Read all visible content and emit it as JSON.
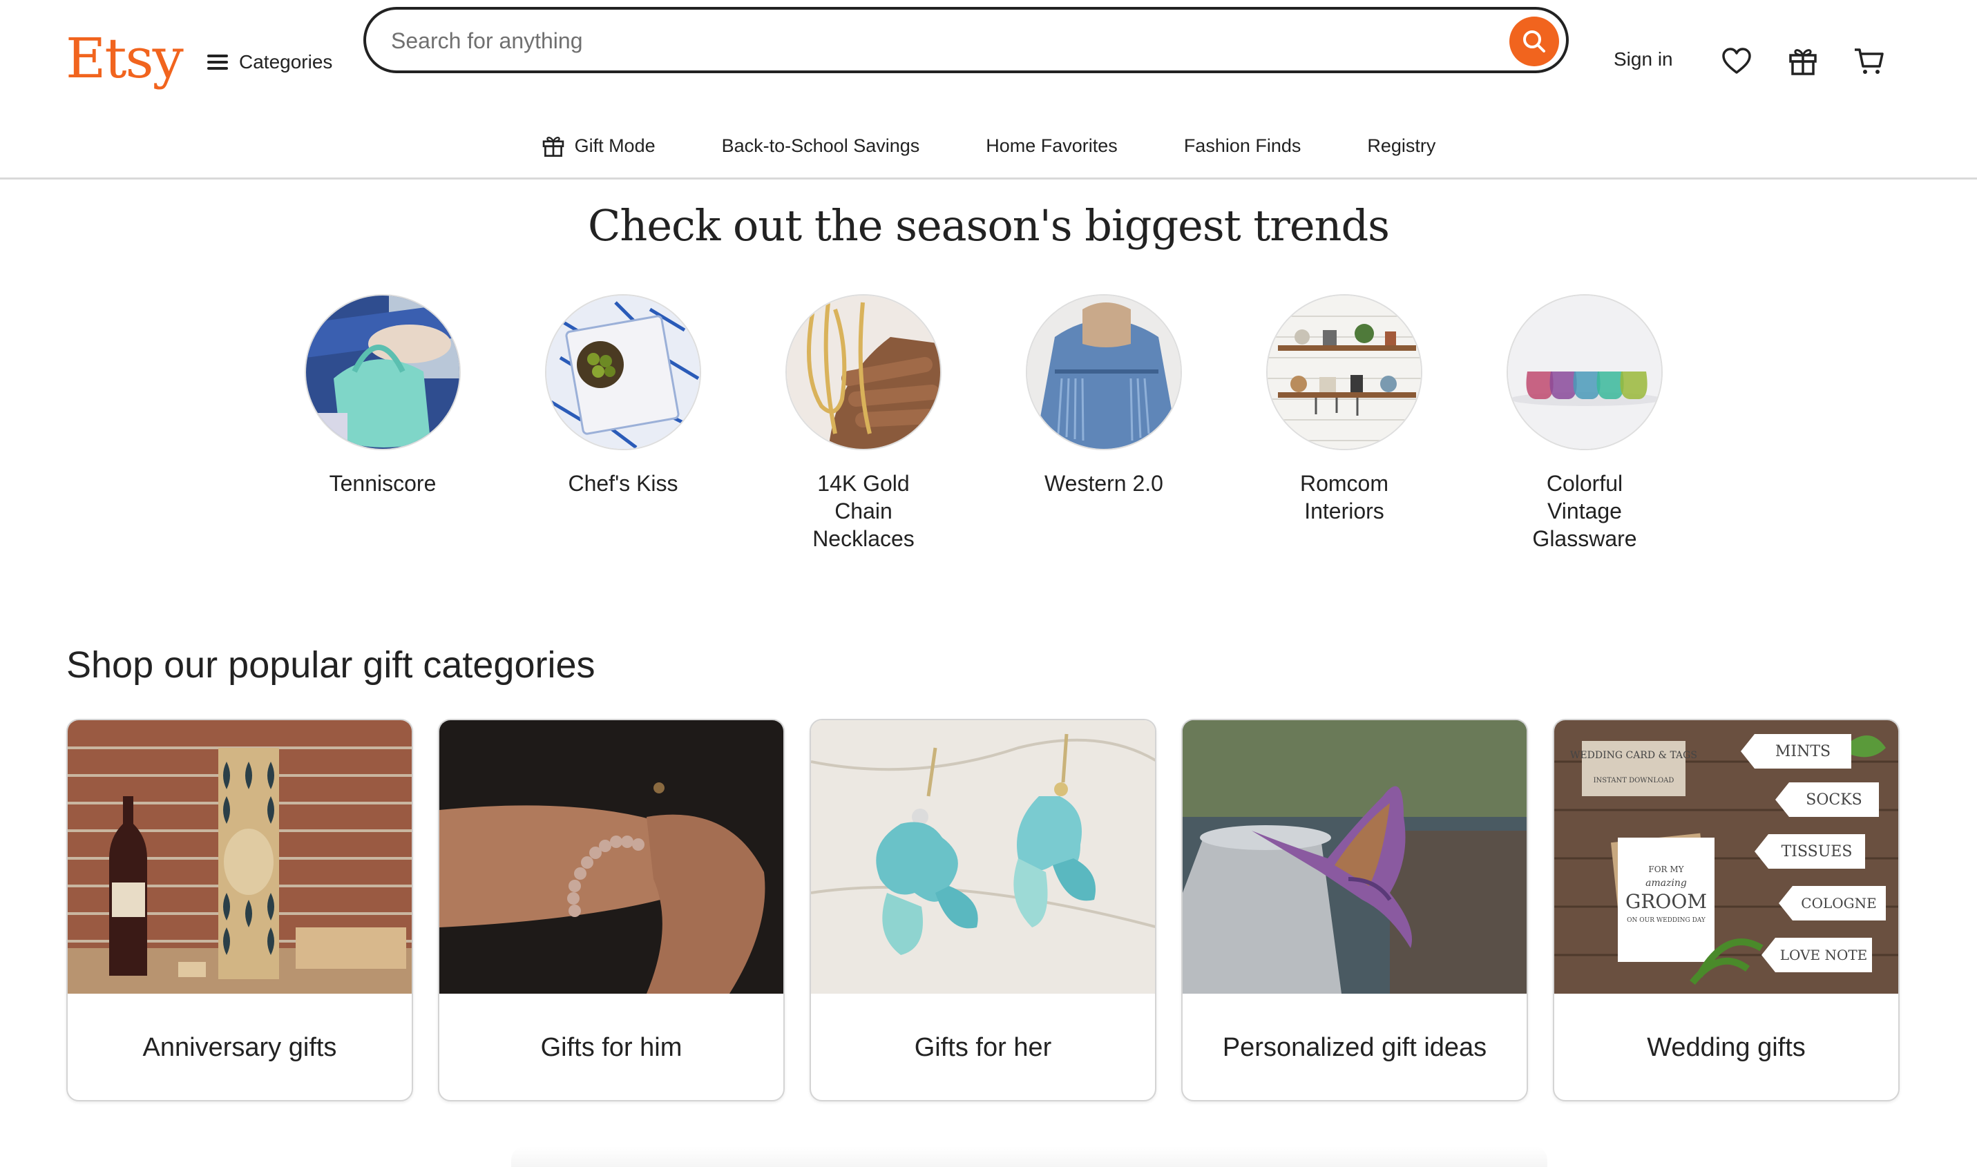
{
  "header": {
    "logo": "Etsy",
    "categories_label": "Categories",
    "search_placeholder": "Search for anything",
    "signin_label": "Sign in"
  },
  "nav": {
    "items": [
      {
        "label": "Gift Mode",
        "icon": "gift-icon"
      },
      {
        "label": "Back-to-School Savings"
      },
      {
        "label": "Home Favorites"
      },
      {
        "label": "Fashion Finds"
      },
      {
        "label": "Registry"
      }
    ]
  },
  "trends": {
    "title": "Check out the season's biggest trends",
    "items": [
      {
        "label": "Tenniscore"
      },
      {
        "label": "Chef's Kiss"
      },
      {
        "label": "14K Gold Chain Necklaces"
      },
      {
        "label": "Western 2.0"
      },
      {
        "label": "Romcom Interiors"
      },
      {
        "label": "Colorful Vintage Glassware"
      }
    ]
  },
  "gifts": {
    "title": "Shop our popular gift categories",
    "items": [
      {
        "label": "Anniversary gifts"
      },
      {
        "label": "Gifts for him"
      },
      {
        "label": "Gifts for her"
      },
      {
        "label": "Personalized gift ideas"
      },
      {
        "label": "Wedding gifts"
      }
    ],
    "wedding_tags": {
      "card_header": "WEDDING CARD & TAGS",
      "card_sub": "INSTANT DOWNLOAD",
      "groom_for": "FOR MY",
      "groom_amazing": "amazing",
      "groom_word": "GROOM",
      "groom_sub": "ON OUR WEDDING DAY",
      "tags": [
        "MINTS",
        "SOCKS",
        "TISSUES",
        "COLOGNE",
        "LOVE NOTE"
      ]
    }
  },
  "colors": {
    "brand": "#F1641E",
    "text": "#222222",
    "border": "#d4d4d4"
  }
}
